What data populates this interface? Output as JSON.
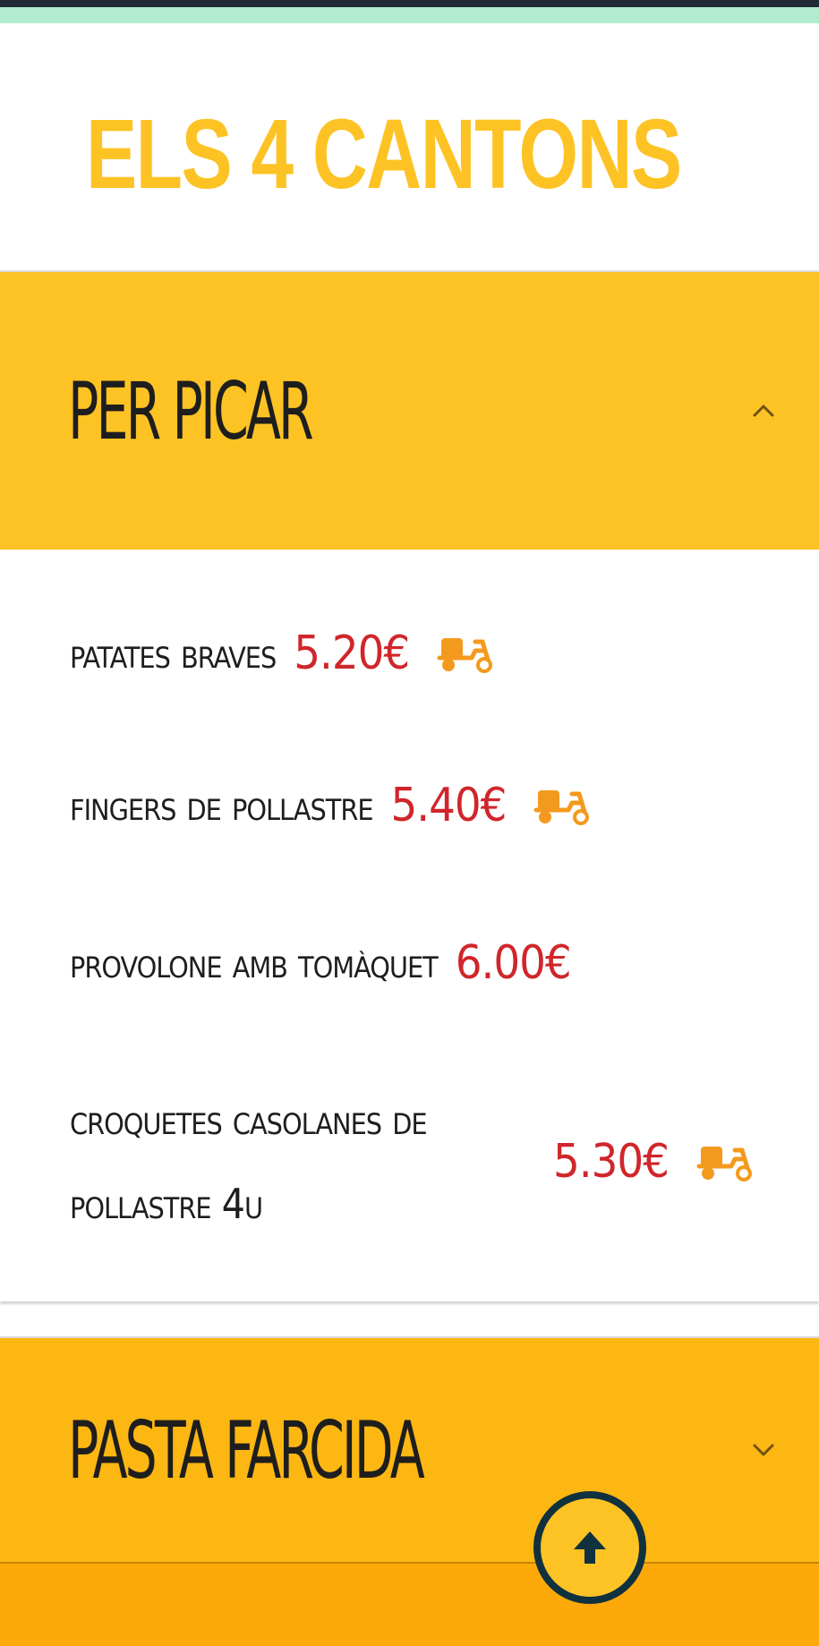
{
  "brand": {
    "title": "ELS 4 CANTONS",
    "color": "#fdc325"
  },
  "sections": [
    {
      "title": "PER PICAR",
      "expanded": true,
      "chevron_icon": "chevron-up-icon"
    },
    {
      "title": "PASTA FARCIDA",
      "expanded": false,
      "chevron_icon": "chevron-down-icon"
    }
  ],
  "items": [
    {
      "name": "Patates braves",
      "price": "5.20€",
      "delivery_icon": "delivery-scooter-icon"
    },
    {
      "name": "Fingers de pollastre",
      "price": "5.40€",
      "delivery_icon": "delivery-scooter-icon"
    },
    {
      "name": "Provolone amb tomàquet",
      "price": "6.00€"
    },
    {
      "name": "Croquetes casolanes de pollastre 4u",
      "price": "5.30€",
      "delivery_icon": "delivery-scooter-icon"
    }
  ],
  "back_to_top_icon": "arrow-up-icon",
  "colors": {
    "header_yellow": "#fdc325",
    "header_orange": "#fdb712",
    "price_red": "#d0262b",
    "scooter_orange": "#f39a1e",
    "button_border": "#10313e"
  }
}
